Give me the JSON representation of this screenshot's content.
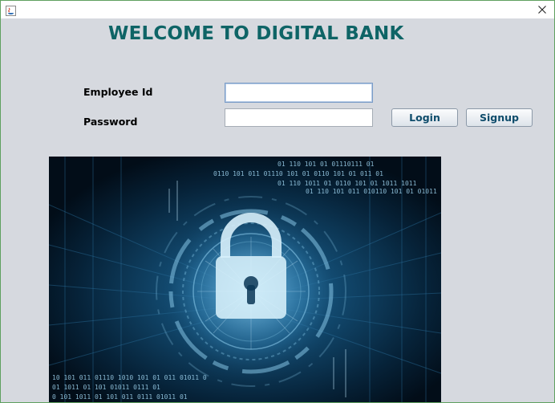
{
  "window": {
    "title": "",
    "icons": {
      "app": "java-app-icon",
      "close": "close-icon"
    }
  },
  "main": {
    "heading": "WELCOME TO DIGITAL BANK",
    "employee_id_label": "Employee Id",
    "employee_id_value": "",
    "password_label": "Password",
    "password_value": ""
  },
  "buttons": {
    "login": "Login",
    "signup": "Signup"
  },
  "image": {
    "icon": "padlock-icon",
    "binary_rows": [
      "01 110 101 01 01110111 01",
      "0110 101 011 01110 101 01 0110 101 01 011 01",
      "01 110 1011 01 0110 101 01 1011 1011",
      "01 110 101 011 010110 101 01 01011",
      "10 101 011 01110 1010 101 01 011 01011 0",
      "01 1011 01 101 01011 0111 01",
      "0 101 1011 01 101 011 0111 01011 01"
    ]
  },
  "colors": {
    "heading": "#0e6466",
    "window_bg": "#d6d9df",
    "button_text": "#0e4c6b",
    "window_border": "#5fa05f",
    "image_glow": "#7fc6ea"
  }
}
